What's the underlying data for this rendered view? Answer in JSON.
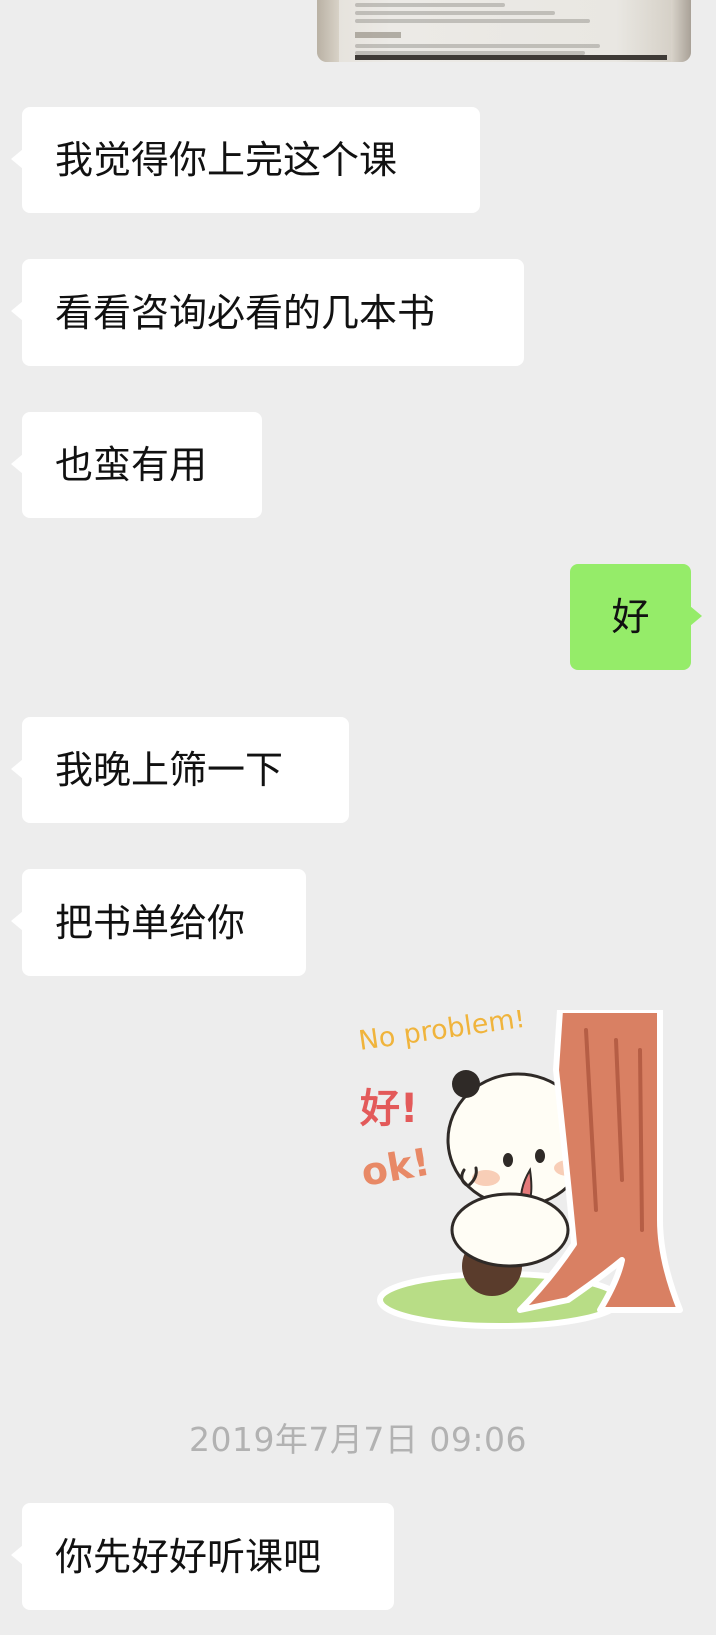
{
  "messages": [
    {
      "side": "left",
      "text": "我觉得你上完这个课"
    },
    {
      "side": "left",
      "text": "看看咨询必看的几本书"
    },
    {
      "side": "left",
      "text": "也蛮有用"
    },
    {
      "side": "right",
      "text": "好"
    },
    {
      "side": "left",
      "text": "我晚上筛一下"
    },
    {
      "side": "left",
      "text": "把书单给你"
    },
    {
      "side": "left",
      "text": "你先好好听课吧"
    }
  ],
  "sticker": {
    "icon": "panda-tree-sticker-icon",
    "text_top": "No problem!",
    "text_mid": "好!",
    "text_bottom": "ok!"
  },
  "timestamp": "2019年7月7日 09:06",
  "colors": {
    "background": "#ededed",
    "bubble_left": "#ffffff",
    "bubble_right": "#95ec69",
    "timestamp": "#b2b2b2"
  }
}
